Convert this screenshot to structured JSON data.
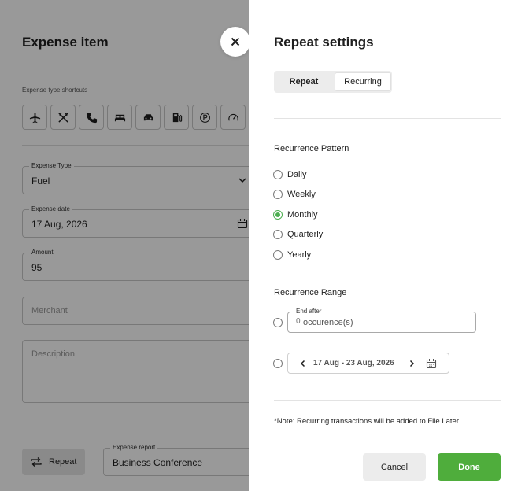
{
  "background": {
    "title": "Expense item",
    "shortcuts_label": "Expense type shortcuts",
    "shortcut_icons": [
      "plane-icon",
      "utensils-icon",
      "phone-icon",
      "bed-icon",
      "car-icon",
      "fuel-pump-icon",
      "parking-icon",
      "speedometer-icon"
    ],
    "expense_type": {
      "label": "Expense Type",
      "value": "Fuel"
    },
    "expense_date": {
      "label": "Expense date",
      "value": "17 Aug, 2026"
    },
    "amount": {
      "label": "Amount",
      "value": "95"
    },
    "merchant": {
      "placeholder": "Merchant"
    },
    "description": {
      "placeholder": "Description"
    },
    "repeat_label": "Repeat",
    "expense_report": {
      "label": "Expense report",
      "value": "Business Conference"
    }
  },
  "panel": {
    "title": "Repeat settings",
    "tabs": [
      {
        "label": "Repeat"
      },
      {
        "label": "Recurring"
      }
    ],
    "recurrence_pattern": {
      "label": "Recurrence Pattern",
      "options": [
        {
          "label": "Daily",
          "checked": false
        },
        {
          "label": "Weekly",
          "checked": false
        },
        {
          "label": "Monthly",
          "checked": true
        },
        {
          "label": "Quarterly",
          "checked": false
        },
        {
          "label": "Yearly",
          "checked": false
        }
      ]
    },
    "recurrence_range": {
      "label": "Recurrence Range",
      "end_after_label": "End after",
      "end_after_placeholder": "0",
      "end_after_suffix": "occurence(s)",
      "date_range": "17 Aug - 23 Aug, 2026"
    },
    "note": "*Note: Recurring transactions will be added to File Later.",
    "cancel_label": "Cancel",
    "done_label": "Done"
  },
  "colors": {
    "accent": "#4fad3c",
    "overlay": "rgba(0,0,0,0.4)"
  }
}
